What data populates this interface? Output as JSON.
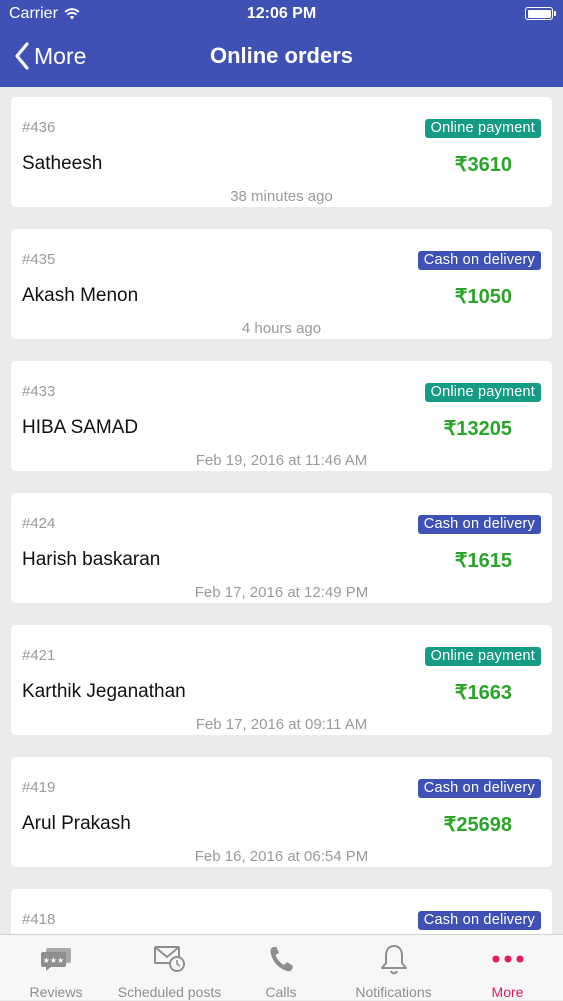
{
  "status_bar": {
    "carrier": "Carrier",
    "time": "12:06 PM"
  },
  "nav": {
    "back_label": "More",
    "title": "Online orders"
  },
  "colors": {
    "accent": "#3f51b5",
    "online_payment": "#169b85",
    "cash_on_delivery": "#3f51b5",
    "amount": "#2aa52a",
    "tab_active": "#e6195b"
  },
  "orders": [
    {
      "number": "#436",
      "payment": "Online payment",
      "payment_type": "online",
      "name": "Satheesh",
      "amount": "₹3610",
      "time": "38 minutes ago"
    },
    {
      "number": "#435",
      "payment": "Cash on delivery",
      "payment_type": "cod",
      "name": "Akash Menon",
      "amount": "₹1050",
      "time": "4 hours ago"
    },
    {
      "number": "#433",
      "payment": "Online payment",
      "payment_type": "online",
      "name": "HIBA SAMAD",
      "amount": "₹13205",
      "time": "Feb 19, 2016 at 11:46 AM"
    },
    {
      "number": "#424",
      "payment": "Cash on delivery",
      "payment_type": "cod",
      "name": "Harish baskaran",
      "amount": "₹1615",
      "time": "Feb 17, 2016 at 12:49 PM"
    },
    {
      "number": "#421",
      "payment": "Online payment",
      "payment_type": "online",
      "name": "Karthik Jeganathan",
      "amount": "₹1663",
      "time": "Feb 17, 2016 at 09:11 AM"
    },
    {
      "number": "#419",
      "payment": "Cash on delivery",
      "payment_type": "cod",
      "name": "Arul Prakash",
      "amount": "₹25698",
      "time": "Feb 16, 2016 at 06:54 PM"
    },
    {
      "number": "#418",
      "payment": "Cash on delivery",
      "payment_type": "cod",
      "name": "",
      "amount": "",
      "time": ""
    }
  ],
  "tabs": [
    {
      "label": "Reviews",
      "icon": "reviews-icon",
      "active": false
    },
    {
      "label": "Scheduled posts",
      "icon": "scheduled-posts-icon",
      "active": false
    },
    {
      "label": "Calls",
      "icon": "phone-icon",
      "active": false
    },
    {
      "label": "Notifications",
      "icon": "bell-icon",
      "active": false
    },
    {
      "label": "More",
      "icon": "more-dots-icon",
      "active": true
    }
  ]
}
